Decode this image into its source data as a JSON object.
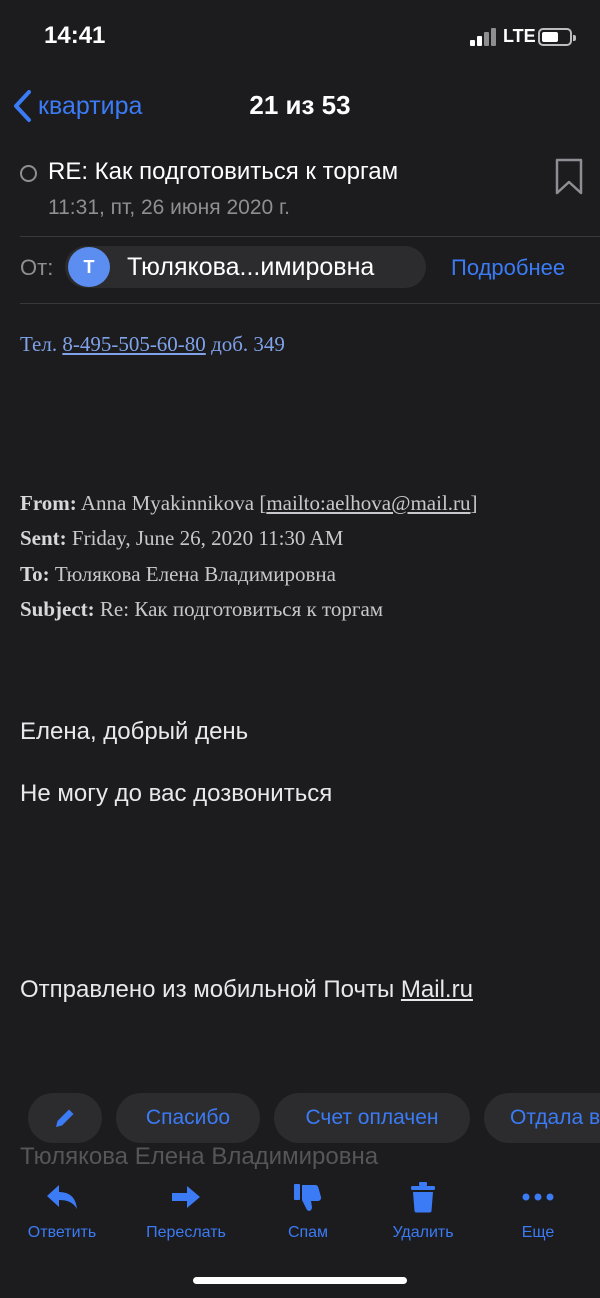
{
  "status_bar": {
    "time": "14:41",
    "network": "LTE"
  },
  "nav": {
    "back_label": "квартира",
    "counter": "21 из 53"
  },
  "message": {
    "subject": "RE: Как подготовиться к торгам",
    "date": "11:31, пт, 26 июня 2020 г.",
    "from_label": "От:",
    "sender_initial": "Т",
    "sender_name": "Тюлякова...имировна",
    "details_link": "Подробнее"
  },
  "body": {
    "tel_prefix": "Тел.",
    "tel_number": "8-495-505-60-80",
    "tel_ext": "доб. 349",
    "quoted": {
      "from_key": "From:",
      "from_value": "Anna Myakinnikova [",
      "from_mailto": "mailto:aelhova@mail.ru",
      "from_close": "]",
      "sent_key": "Sent:",
      "sent_value": "Friday, June 26, 2020 11:30 AM",
      "to_key": "To:",
      "to_value": "Тюлякова Елена Владимировна",
      "subject_key": "Subject:",
      "subject_value": "Re: Как подготовиться к торгам"
    },
    "greeting": "Елена, добрый день",
    "line2": "Не могу до вас дозвониться",
    "signature_prefix": "Отправлено из мобильной Почты ",
    "signature_link": "Mail.ru",
    "faded_line": "Тюлякова Елена Владимировна"
  },
  "quick_replies": [
    "Спасибо",
    "Счет оплачен",
    "Отдала в"
  ],
  "toolbar": {
    "reply": "Ответить",
    "forward": "Переслать",
    "spam": "Спам",
    "delete": "Удалить",
    "more": "Еще"
  },
  "colors": {
    "accent": "#3b7bf5",
    "background": "#1c1c1e",
    "avatar": "#5b8ef0"
  }
}
